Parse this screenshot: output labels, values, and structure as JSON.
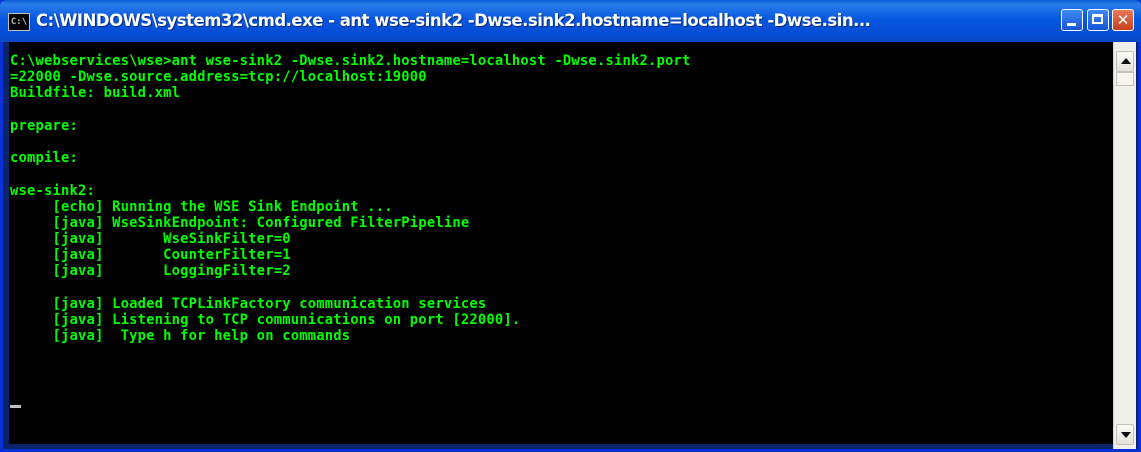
{
  "window": {
    "title": "C:\\WINDOWS\\system32\\cmd.exe - ant wse-sink2 -Dwse.sink2.hostname=localhost -Dwse.sin...",
    "icon": "cmd-icon",
    "icon_text": "C:\\",
    "buttons": {
      "minimize": "minimize-icon",
      "maximize": "maximize-icon",
      "close": "close-icon",
      "close_glyph": "✕"
    }
  },
  "console": {
    "lines": [
      "C:\\webservices\\wse>ant wse-sink2 -Dwse.sink2.hostname=localhost -Dwse.sink2.port",
      "=22000 -Dwse.source.address=tcp://localhost:19000",
      "Buildfile: build.xml",
      "",
      "prepare:",
      "",
      "compile:",
      "",
      "wse-sink2:",
      "     [echo] Running the WSE Sink Endpoint ...",
      "     [java] WseSinkEndpoint: Configured FilterPipeline",
      "     [java]       WseSinkFilter=0",
      "     [java]       CounterFilter=1",
      "     [java]       LoggingFilter=2",
      "",
      "     [java] Loaded TCPLinkFactory communication services",
      "     [java] Listening to TCP communications on port [22000].",
      "     [java]  Type h for help on commands"
    ],
    "text_color": "#00ff00",
    "background": "#000000"
  },
  "scrollbar": {
    "up_icon": "scroll-up-icon",
    "down_icon": "scroll-down-icon"
  }
}
